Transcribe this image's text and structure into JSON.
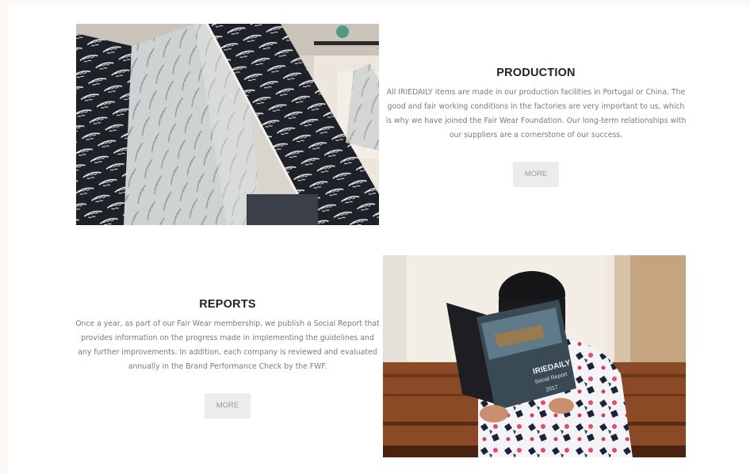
{
  "production": {
    "title": "PRODUCTION",
    "text": "All IRIEDAILY items are made in our production facilities in Portugal or China. The good and fair working conditions in the factories are very important to us, which is why we have joined the Fair Wear Foundation. Our long-term relationships with our suppliers are a cornerstone of our success.",
    "more_label": "MORE"
  },
  "reports": {
    "title": "REPORTS",
    "text": "Once a year, as part of our Fair Wear membership, we publish a Social Report that provides information on the progress made in implementing the guidelines and any further improvements. In addition, each company is reviewed and evaluated annually in the Brand Performance Check by the FWF.",
    "more_label": "MORE",
    "booklet_title": "IRIEDAILY",
    "booklet_subtitle": "Social Report",
    "booklet_year": "2017"
  }
}
